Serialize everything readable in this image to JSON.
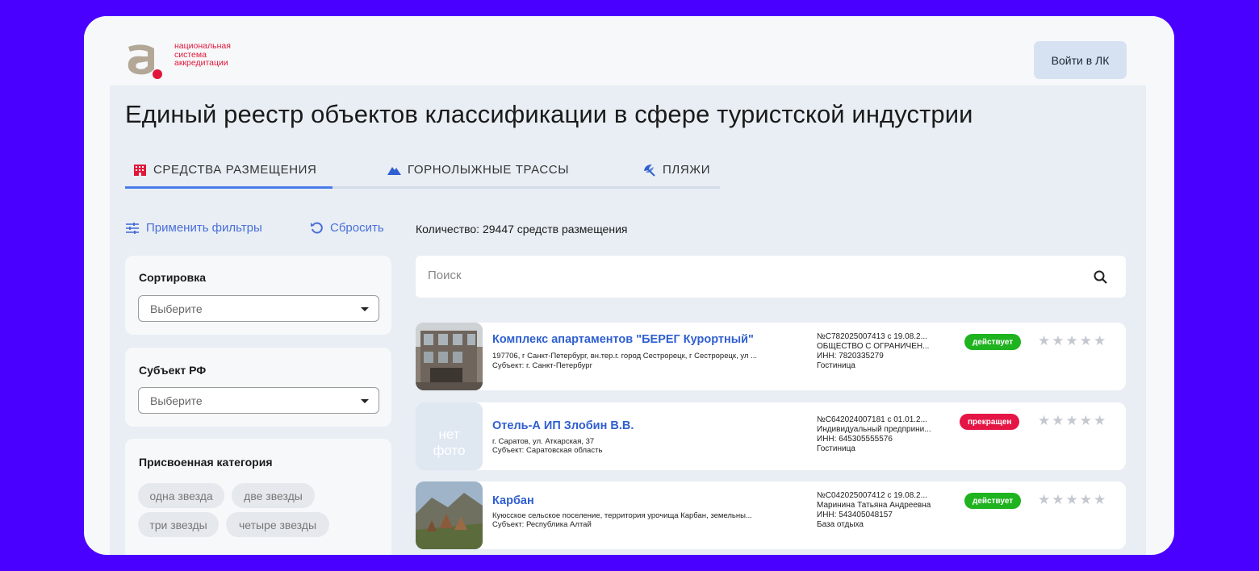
{
  "logo": {
    "lines": [
      "национальная",
      "система",
      "аккредитации"
    ]
  },
  "header": {
    "login_label": "Войти в ЛК"
  },
  "page_title": "Единый реестр объектов классификации в сфере туристской индустрии",
  "tabs": [
    {
      "label": "СРЕДСТВА РАЗМЕЩЕНИЯ",
      "icon": "building-icon",
      "active": true
    },
    {
      "label": "ГОРНОЛЫЖНЫЕ ТРАССЫ",
      "icon": "mountain-icon",
      "active": false
    },
    {
      "label": "ПЛЯЖИ",
      "icon": "umbrella-icon",
      "active": false
    }
  ],
  "actions": {
    "apply_filters": "Применить фильтры",
    "reset": "Сбросить"
  },
  "count_text": "Количество: 29447 средств размещения",
  "filters": {
    "sort": {
      "title": "Сортировка",
      "placeholder": "Выберите"
    },
    "region": {
      "title": "Субъект РФ",
      "placeholder": "Выберите"
    },
    "category": {
      "title": "Присвоенная категория",
      "options": [
        "одна звезда",
        "две звезды",
        "три звезды",
        "четыре звезды"
      ]
    }
  },
  "search": {
    "placeholder": "Поиск"
  },
  "no_photo": {
    "line1": "нет",
    "line2": "фото"
  },
  "results": [
    {
      "name": "Комплекс апартаментов \"БЕРЕГ Курортный\"",
      "address": "197706, г Санкт-Петербург, вн.тер.г. город Сестрорецк, г Сестрорецк, ул ...",
      "subject": "Субъект: г. Санкт-Петербург",
      "reg_number": "№С782025007413 с 19.08.2...",
      "org": "ОБЩЕСТВО С ОГРАНИЧЕН...",
      "inn": "ИНН: 7820335279",
      "type": "Гостиница",
      "status": "действует",
      "status_color": "#1fb31f",
      "stars": 0
    },
    {
      "name": "Отель-А ИП Злобин В.В.",
      "address": "г. Саратов, ул. Аткарская, 37",
      "subject": "Субъект: Саратовская область",
      "reg_number": "№С642024007181 с 01.01.2...",
      "org": "Индивидуальный предприни...",
      "inn": "ИНН: 645305555576",
      "type": "Гостиница",
      "status": "прекращен",
      "status_color": "#e51646",
      "stars": 0
    },
    {
      "name": "Карбан",
      "address": "Куюсское сельское поселение, территория урочища Карбан, земельны...",
      "subject": "Субъект: Республика Алтай",
      "reg_number": "№С042025007412 с 19.08.2...",
      "org": "Маринина Татьяна Андреевна",
      "inn": "ИНН: 543405048157",
      "type": "База отдыха",
      "status": "действует",
      "status_color": "#1fb31f",
      "stars": 0
    }
  ]
}
